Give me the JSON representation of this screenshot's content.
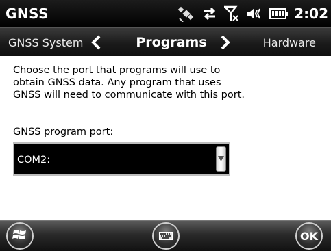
{
  "status_bar": {
    "app_title": "GNSS",
    "time": "2:02",
    "icons": [
      "gnss-satellite-icon",
      "data-connection-icon",
      "no-signal-icon",
      "speaker-icon",
      "battery-icon"
    ]
  },
  "header": {
    "prev_label": "GNSS System",
    "title": "Programs",
    "next_label": "Hardware"
  },
  "content": {
    "description": "Choose the port that programs will use to obtain GNSS data.  Any program that uses GNSS will need to communicate with this port.",
    "port_label": "GNSS program port:",
    "port_value": "COM2:"
  },
  "softkeys": {
    "ok_label": "OK",
    "icons": [
      "windows-start-icon",
      "keyboard-icon"
    ]
  },
  "colors": {
    "bar_background": "#000000",
    "content_background": "#ffffff",
    "text": "#000000"
  }
}
